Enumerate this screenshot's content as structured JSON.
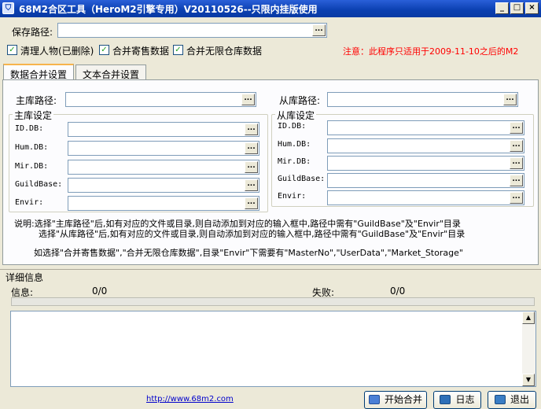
{
  "window": {
    "title": "68M2合区工具（HeroM2引擎专用）V20110526--只限内挂版使用",
    "minimize": "_",
    "maximize": "□",
    "close": "×"
  },
  "save_path": {
    "label": "保存路径:",
    "value": "",
    "browse": "..."
  },
  "options": {
    "clear_characters": {
      "label": "清理人物(已删除)",
      "checked": true
    },
    "merge_consignment": {
      "label": "合并寄售数据",
      "checked": true
    },
    "merge_unlimited_storage": {
      "label": "合并无限仓库数据",
      "checked": true
    }
  },
  "notice": "注意：此程序只适用于2009-11-10之后的M2",
  "tabs": [
    {
      "label": "数据合并设置",
      "active": true
    },
    {
      "label": "文本合并设置",
      "active": false
    }
  ],
  "main_db": {
    "path_label": "主库路径:",
    "path_value": "",
    "group_title": "主库设定",
    "fields": [
      {
        "label": "ID.DB:",
        "value": ""
      },
      {
        "label": "Hum.DB:",
        "value": ""
      },
      {
        "label": "Mir.DB:",
        "value": ""
      },
      {
        "label": "GuildBase:",
        "value": ""
      },
      {
        "label": "Envir:",
        "value": ""
      }
    ]
  },
  "slave_db": {
    "path_label": "从库路径:",
    "path_value": "",
    "group_title": "从库设定",
    "fields": [
      {
        "label": "ID.DB:",
        "value": ""
      },
      {
        "label": "Hum.DB:",
        "value": ""
      },
      {
        "label": "Mir.DB:",
        "value": ""
      },
      {
        "label": "GuildBase:",
        "value": ""
      },
      {
        "label": "Envir:",
        "value": ""
      }
    ]
  },
  "instructions": {
    "line1": "说明:选择\"主库路径\"后,如有对应的文件或目录,则自动添加到对应的输入框中,路径中需有\"GuildBase\"及\"Envir\"目录",
    "line2": "选择\"从库路径\"后,如有对应的文件或目录,则自动添加到对应的输入框中,路径中需有\"GuildBase\"及\"Envir\"目录",
    "line3": "如选择\"合并寄售数据\",\"合并无限仓库数据\",目录\"Envir\"下需要有\"MasterNo\",\"UserData\",\"Market_Storage\""
  },
  "details": {
    "header": "详细信息",
    "info_label": "信息:",
    "info_value": "0/0",
    "fail_label": "失败:",
    "fail_value": "0/0",
    "progress": 0,
    "log_text": ""
  },
  "footer": {
    "link": "http://www.68m2.com",
    "start_button": "开始合并",
    "log_button": "日志",
    "exit_button": "退出"
  },
  "colors": {
    "notice": "#ff0000",
    "link": "#0000cc",
    "titlebar": "#0a3fb0"
  }
}
